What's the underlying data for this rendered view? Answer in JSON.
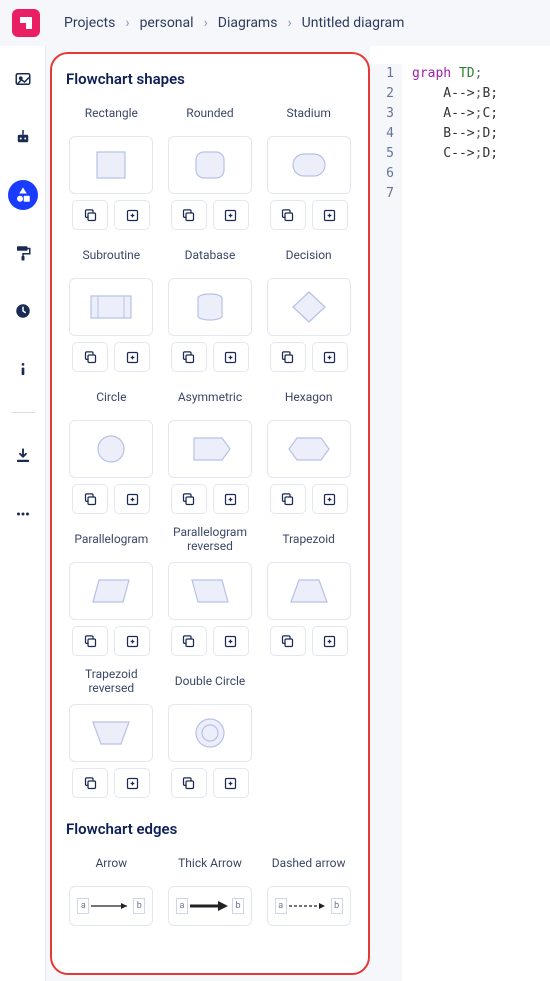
{
  "breadcrumbs": [
    "Projects",
    "personal",
    "Diagrams",
    "Untitled diagram"
  ],
  "sections": {
    "shapes_title": "Flowchart shapes",
    "edges_title": "Flowchart edges"
  },
  "shapes": [
    {
      "label": "Rectangle"
    },
    {
      "label": "Rounded"
    },
    {
      "label": "Stadium"
    },
    {
      "label": "Subroutine"
    },
    {
      "label": "Database"
    },
    {
      "label": "Decision"
    },
    {
      "label": "Circle"
    },
    {
      "label": "Asymmetric"
    },
    {
      "label": "Hexagon"
    },
    {
      "label": "Parallelogram"
    },
    {
      "label": "Parallelogram reversed"
    },
    {
      "label": "Trapezoid"
    },
    {
      "label": "Trapezoid reversed"
    },
    {
      "label": "Double Circle"
    }
  ],
  "edges": [
    {
      "label": "Arrow"
    },
    {
      "label": "Thick Arrow"
    },
    {
      "label": "Dashed arrow"
    }
  ],
  "edge_node_a": "a",
  "edge_node_b": "b",
  "code": {
    "line_numbers": [
      "1",
      "2",
      "3",
      "4",
      "5",
      "6",
      "7"
    ],
    "keyword": "graph",
    "direction": "TD",
    "edges_code": [
      "A-->B;",
      "A-->C;",
      "B-->D;",
      "C-->D;"
    ]
  }
}
